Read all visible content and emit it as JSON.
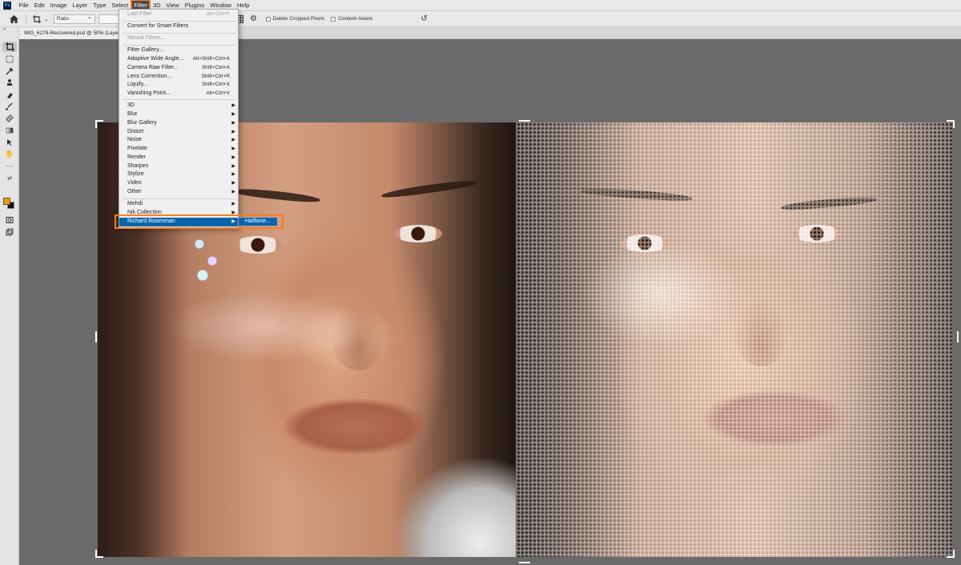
{
  "app": {
    "logo_text": "Ps"
  },
  "menubar": {
    "items": [
      "File",
      "Edit",
      "Image",
      "Layer",
      "Type",
      "Select",
      "Filter",
      "3D",
      "View",
      "Plugins",
      "Window",
      "Help"
    ],
    "active": "Filter"
  },
  "options": {
    "ratio_label": "Ratio",
    "delete_cropped": "Delete Cropped Pixels",
    "content_aware": "Content-Aware",
    "partial_text": "n"
  },
  "document": {
    "tab_title": "IMG_6279-Recovered.psd @ 50% (Layer"
  },
  "tools": {
    "collapse": "»",
    "icons": [
      "crop-tool",
      "marquee-tool",
      "eyedropper-tool",
      "stamp-tool",
      "eraser-tool",
      "brush-tool",
      "healing-tool",
      "gradient-tool",
      "path-select-tool",
      "hand-tool",
      "more-tools"
    ],
    "selected": "crop-tool"
  },
  "filter_menu": {
    "last_filter": {
      "label": "Last Filter",
      "shortcut": "Alt+Ctrl+F"
    },
    "convert": "Convert for Smart Filters",
    "neural": "Neural Filters...",
    "gallery_items": [
      {
        "label": "Filter Gallery...",
        "shortcut": ""
      },
      {
        "label": "Adaptive Wide Angle...",
        "shortcut": "Alt+Shift+Ctrl+A"
      },
      {
        "label": "Camera Raw Filter...",
        "shortcut": "Shift+Ctrl+A"
      },
      {
        "label": "Lens Correction...",
        "shortcut": "Shift+Ctrl+R"
      },
      {
        "label": "Liquify...",
        "shortcut": "Shift+Ctrl+X"
      },
      {
        "label": "Vanishing Point...",
        "shortcut": "Alt+Ctrl+V"
      }
    ],
    "submenus": [
      "3D",
      "Blur",
      "Blur Gallery",
      "Distort",
      "Noise",
      "Pixelate",
      "Render",
      "Sharpen",
      "Stylize",
      "Video",
      "Other"
    ],
    "plugins": [
      "Mehdi",
      "Nik Collection",
      "Richard Rosenman"
    ],
    "highlighted": "Richard Rosenman",
    "arrow": "▶"
  },
  "submenu": {
    "item": "Halftone..."
  },
  "colors": {
    "accent_highlight": "#ff7b1a",
    "selection_blue": "#0a64ad",
    "foreground_swatch": "#f79a00",
    "background_swatch": "#111111"
  }
}
